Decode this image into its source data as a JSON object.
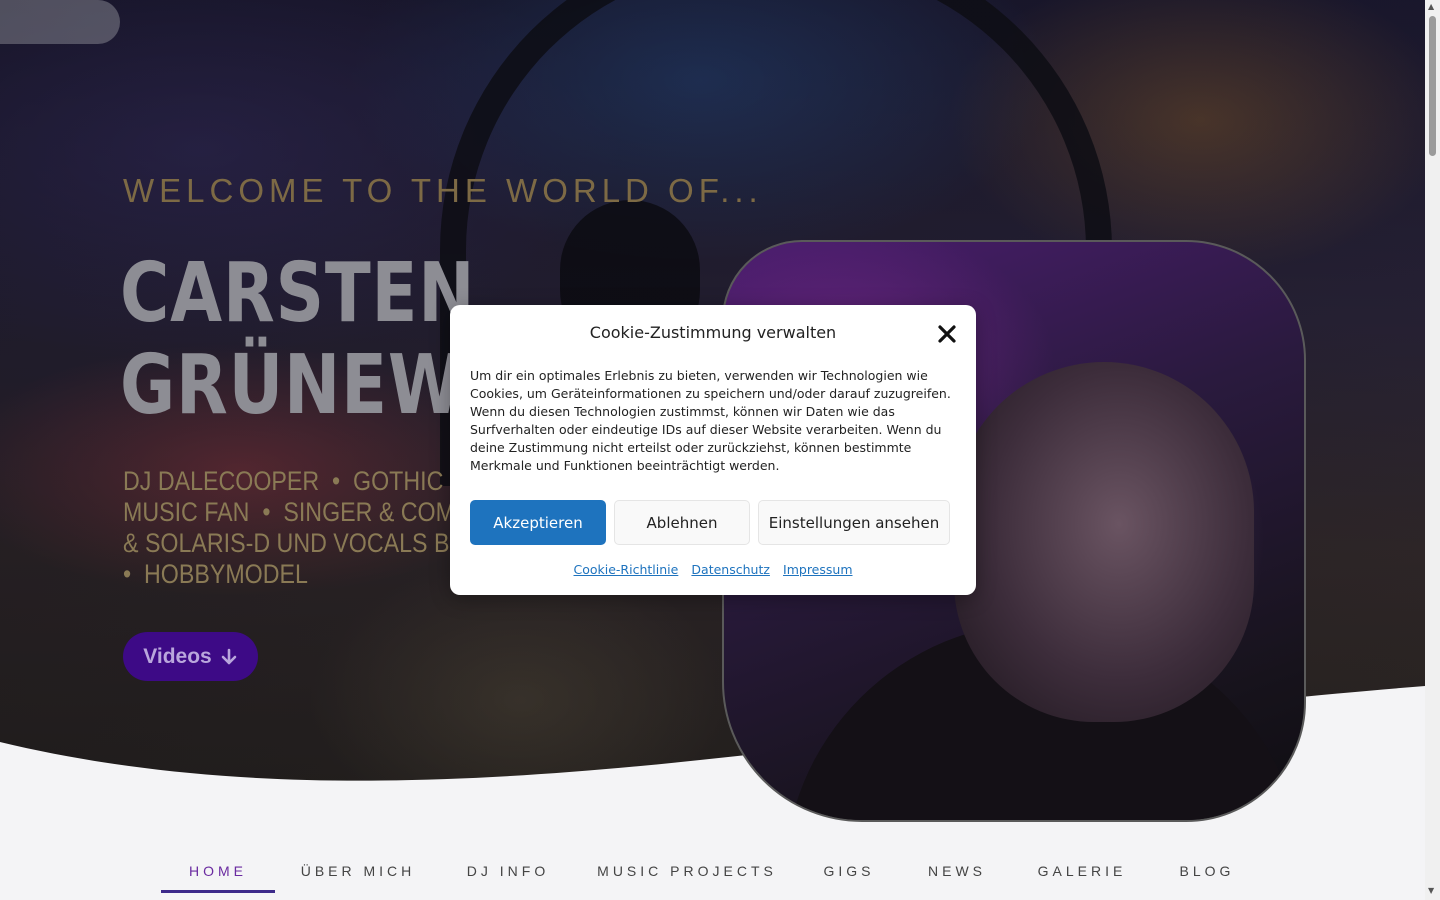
{
  "hero": {
    "eyebrow": "WELCOME TO THE WORLD OF...",
    "title_line1": "CARSTEN",
    "title_line2": "GRÜNEWA",
    "roles_line1": "DJ DALECOOPER  •  GOTHIC DJ",
    "roles_line2": "MUSIC FAN  •  SINGER & COMPO",
    "roles_line3": "& SOLARIS-D UND VOCALS BEI A",
    "roles_line4": "•  HOBBYMODEL",
    "videos_label": "Videos",
    "videos_icon": "arrow-down-icon"
  },
  "nav": {
    "items": [
      {
        "label": "HOME",
        "active": true
      },
      {
        "label": "ÜBER MICH",
        "active": false
      },
      {
        "label": "DJ INFO",
        "active": false
      },
      {
        "label": "MUSIC PROJECTS",
        "active": false
      },
      {
        "label": "GIGS",
        "active": false
      },
      {
        "label": "NEWS",
        "active": false
      },
      {
        "label": "GALERIE",
        "active": false
      },
      {
        "label": "BLOG",
        "active": false
      }
    ]
  },
  "cookie_modal": {
    "title": "Cookie-Zustimmung verwalten",
    "close_icon": "close-icon",
    "text": "Um dir ein optimales Erlebnis zu bieten, verwenden wir Technologien wie Cookies, um Geräteinformationen zu speichern und/oder darauf zuzugreifen. Wenn du diesen Technologien zustimmst, können wir Daten wie das Surfverhalten oder eindeutige IDs auf dieser Website verarbeiten. Wenn du deine Zustimmung nicht erteilst oder zurückziehst, können bestimmte Merkmale und Funktionen beeinträchtigt werden.",
    "accept_label": "Akzeptieren",
    "deny_label": "Ablehnen",
    "settings_label": "Einstellungen ansehen",
    "links": [
      "Cookie-Richtlinie",
      "Datenschutz",
      "Impressum"
    ]
  },
  "colors": {
    "accent": "#1e73be",
    "nav_active": "#6a2aa0",
    "videos_button": "#3d0a86"
  }
}
